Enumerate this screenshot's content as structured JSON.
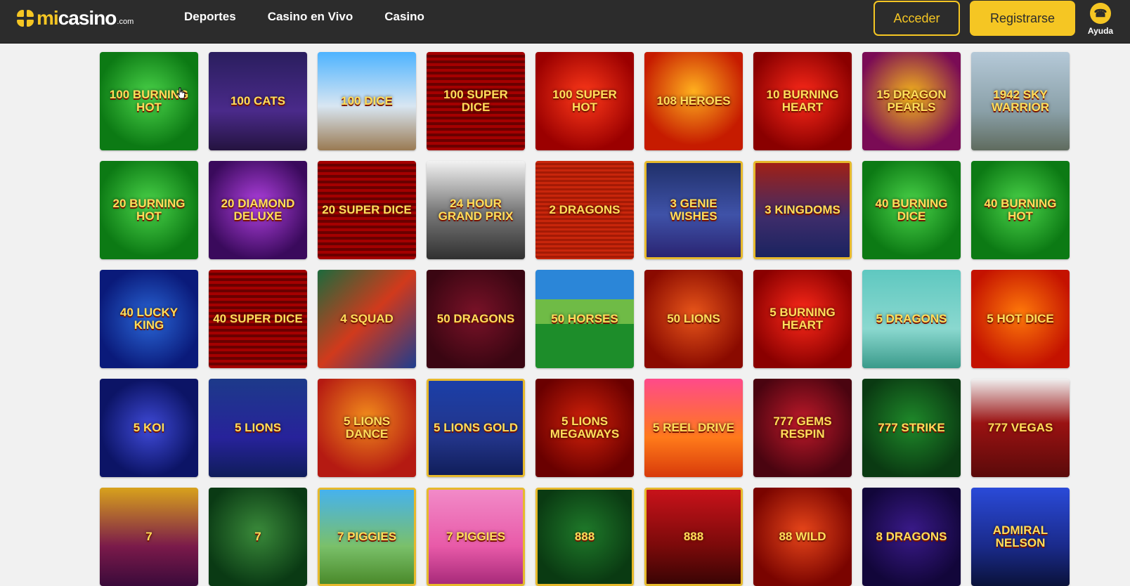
{
  "header": {
    "logo": {
      "mi": "mi",
      "casino": "casino",
      "com": ".com"
    },
    "nav": [
      "Deportes",
      "Casino en Vivo",
      "Casino"
    ],
    "login_label": "Acceder",
    "register_label": "Registrarse",
    "help_label": "Ayuda",
    "colors": {
      "bar": "#2c2c2c",
      "accent": "#f5c623"
    }
  },
  "games": [
    {
      "title": "100 BURNING HOT",
      "bg": "radial-gradient(circle at 50% 45%, #4bd44a, #0c7a14 70%)"
    },
    {
      "title": "100 CATS",
      "bg": "linear-gradient(180deg, #2a1e5e, #4a2a8a 60%, #24133f)"
    },
    {
      "title": "100 DICE",
      "bg": "linear-gradient(180deg, #4db3ff, #d8e6f2 55%, #9a7a52)"
    },
    {
      "title": "100 SUPER DICE",
      "bg": "repeating-linear-gradient(180deg, #a40000 0 4px, #6a0000 4px 8px)"
    },
    {
      "title": "100 SUPER HOT",
      "bg": "radial-gradient(circle at 50% 45%, #ff3a1a, #9b0000 75%)"
    },
    {
      "title": "108 HEROES",
      "bg": "radial-gradient(circle at 50% 40%, #ffb01e, #c61b00 70%)"
    },
    {
      "title": "10 Burning Heart",
      "bg": "radial-gradient(circle at 50% 45%, #ff2a1a, #8a0000 75%)"
    },
    {
      "title": "15 DRAGON PEARLS",
      "bg": "radial-gradient(circle at 50% 45%, #f7b91a, #7a0b55 75%)"
    },
    {
      "title": "1942 SKY WARRIOR",
      "bg": "linear-gradient(180deg, #b5c9d8, #8aa0a8 60%, #5f6b5e)"
    },
    {
      "title": "20 BURNING HOT",
      "bg": "radial-gradient(circle at 50% 45%, #4bd44a, #0c7a14 70%)"
    },
    {
      "title": "20 Diamond Deluxe",
      "bg": "radial-gradient(circle at 50% 45%, #b040e0, #3a0a5c 75%)"
    },
    {
      "title": "20 SUPER DICE",
      "bg": "repeating-linear-gradient(180deg, #a40000 0 4px, #6a0000 4px 8px)"
    },
    {
      "title": "24 HOUR Grand Prix",
      "bg": "linear-gradient(180deg, #f2f2f2, #7c7c7c 50%, #303030)"
    },
    {
      "title": "2 DRAGONS",
      "bg": "repeating-linear-gradient(180deg, #c8260b 0 3px, #a41a05 3px 6px)"
    },
    {
      "title": "3 Genie Wishes",
      "bg": "linear-gradient(180deg, #20306a, #3f52a8 55%, #2a2472)",
      "frame": true
    },
    {
      "title": "3 Kingdoms",
      "bg": "linear-gradient(180deg, #a02016, #3c2c6a 60%, #1a2360)",
      "frame": true
    },
    {
      "title": "40 BURNING DICE",
      "bg": "radial-gradient(circle at 50% 45%, #4bd44a, #0c7a14 70%)"
    },
    {
      "title": "40 BURNING HOT",
      "bg": "radial-gradient(circle at 50% 45%, #4bd44a, #0c7a14 70%)"
    },
    {
      "title": "40 Lucky King",
      "bg": "radial-gradient(circle at 50% 50%, #2a67d8, #0a1a7a 75%)"
    },
    {
      "title": "40 SUPER DICE",
      "bg": "repeating-linear-gradient(180deg, #a40000 0 4px, #6a0000 4px 8px)"
    },
    {
      "title": "4 SQUAD",
      "bg": "linear-gradient(135deg, #1c6a3c, #d13a1c 50%, #1e3d8f)"
    },
    {
      "title": "50 DRAGONS",
      "bg": "radial-gradient(circle at 50% 45%, #7a1228, #3a0612 75%)"
    },
    {
      "title": "50 HORSES",
      "bg": "linear-gradient(180deg, #2b86d8 0 30%, #6fbb46 30% 55%, #1d8d2a 55%)"
    },
    {
      "title": "50 LIONS",
      "bg": "radial-gradient(circle at 50% 45%, #e8561a, #8a0a00 75%)"
    },
    {
      "title": "5 Burning Heart",
      "bg": "radial-gradient(circle at 50% 45%, #ff2a1a, #8a0000 75%)"
    },
    {
      "title": "5 DRAGONS",
      "bg": "linear-gradient(180deg, #5fc8c0, #8ad8cf 60%, #3a9a8a)"
    },
    {
      "title": "5 HOT DICE",
      "bg": "radial-gradient(circle at 50% 45%, #ff7a0a, #c41200 75%)"
    },
    {
      "title": "5 KOI",
      "bg": "radial-gradient(circle at 50% 50%, #3f4ad8, #0c1466 70%)"
    },
    {
      "title": "5 LIONS",
      "bg": "linear-gradient(180deg, #1d3a8a, #27229a 60%, #0f1d5a)"
    },
    {
      "title": "5 LIONS DANCE",
      "bg": "radial-gradient(circle at 50% 40%, #f28c1c, #b51a12 75%)"
    },
    {
      "title": "5 LIONS GOLD",
      "bg": "linear-gradient(180deg, #1b3fa8, #23358a 60%, #101e5a)",
      "frame": true
    },
    {
      "title": "5 LIONS MEGAWAYS",
      "bg": "radial-gradient(circle at 50% 45%, #d2220a, #6a0000 75%)"
    },
    {
      "title": "5 Reel Drive",
      "bg": "linear-gradient(180deg, #ff4a8a, #ff7a1a 60%, #d83a0a)"
    },
    {
      "title": "777 GEMS RESPIN",
      "bg": "radial-gradient(circle at 50% 45%, #c01a2a, #4a0410 75%)"
    },
    {
      "title": "777 Strike",
      "bg": "radial-gradient(circle at 50% 45%, #1f8a2a, #0a3a12 75%)"
    },
    {
      "title": "777 VEGAS",
      "bg": "linear-gradient(180deg, #f0f0f0, #9a1212 45%, #5a0a0a)"
    },
    {
      "title": "7",
      "bg": "linear-gradient(180deg, #d8a21c, #7a1a4a 60%, #3a0a3a)"
    },
    {
      "title": "7",
      "bg": "radial-gradient(circle at 50% 45%, #3a8a3a, #0a3a14 75%)"
    },
    {
      "title": "7 PIGGIES",
      "bg": "linear-gradient(180deg, #46b2ee, #7ac06a 60%, #4a8a2a)",
      "frame": true
    },
    {
      "title": "7 PIGGIES",
      "bg": "linear-gradient(180deg, #f28ac8, #e85aa8 60%, #a82a7a)",
      "frame": true
    },
    {
      "title": "888",
      "bg": "radial-gradient(circle at 50% 45%, #1f7a2a, #0a3a12 75%)",
      "frame": true
    },
    {
      "title": "888",
      "bg": "linear-gradient(180deg, #c8121a, #7a0a0a 60%, #3a0404)",
      "frame": true
    },
    {
      "title": "88 WILD",
      "bg": "radial-gradient(circle at 50% 45%, #e8461a, #7a0400 75%)"
    },
    {
      "title": "8 Dragons",
      "bg": "radial-gradient(circle at 50% 45%, #3a1a8a, #12063a 75%)"
    },
    {
      "title": "Admiral Nelson",
      "bg": "linear-gradient(180deg, #2a4ad8, #1a2a8a 60%, #0a123a)"
    }
  ]
}
